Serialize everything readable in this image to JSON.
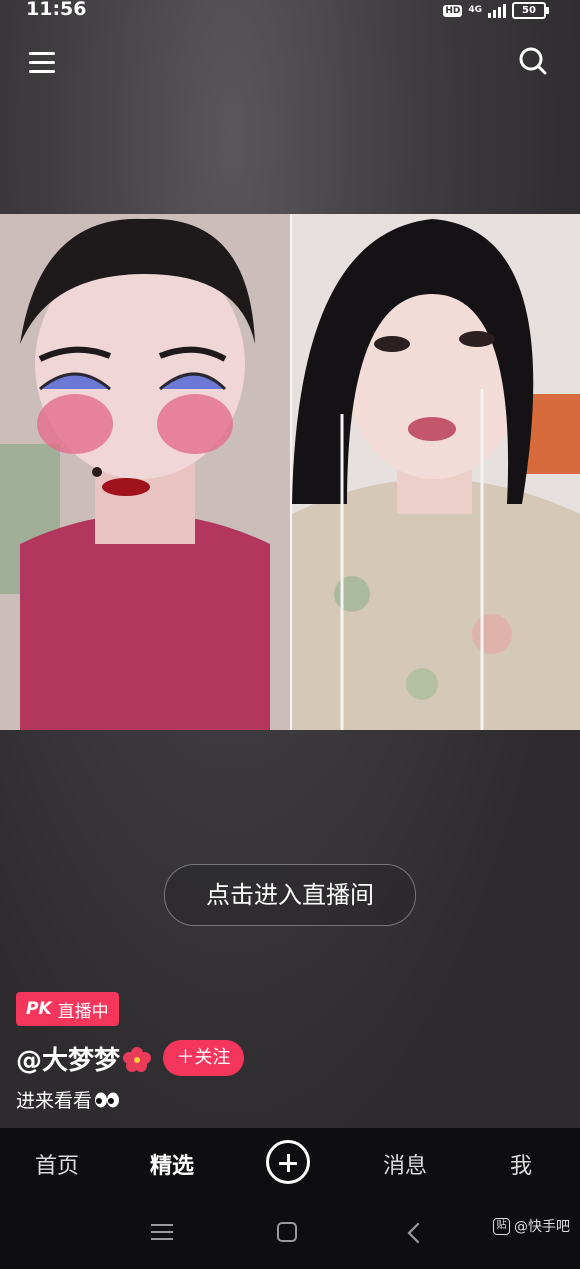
{
  "status_bar": {
    "time": "11:56",
    "hd": "HD",
    "network": "4G",
    "battery": "50"
  },
  "header": {
    "menu_icon": "menu-icon",
    "search_icon": "search-icon"
  },
  "stream": {
    "enter_live_label": "点击进入直播间",
    "left_pane": "video-host-left",
    "right_pane": "video-host-right"
  },
  "live_info": {
    "badge_pk": "PK",
    "badge_text": "直播中",
    "username": "@大梦梦",
    "follow_label": "＋关注",
    "caption": "进来看看"
  },
  "tabbar": {
    "home": "首页",
    "featured": "精选",
    "messages": "消息",
    "me": "我"
  },
  "watermark": {
    "text": "@快手吧",
    "logo": "贴"
  },
  "colors": {
    "accent": "#f4365c",
    "background": "#2e2c2f",
    "tabbar": "#0e0e10"
  }
}
